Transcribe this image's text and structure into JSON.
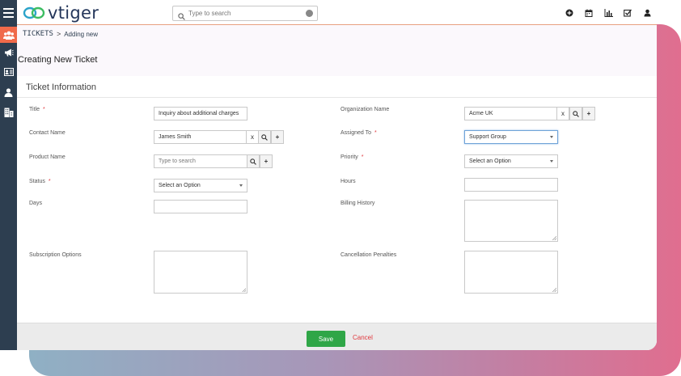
{
  "brand": {
    "name": "vtiger"
  },
  "search": {
    "placeholder": "Type to search"
  },
  "top_icons": [
    "plus-circle-icon",
    "calendar-icon",
    "bar-chart-icon",
    "checkbox-icon",
    "user-icon"
  ],
  "sidebar": {
    "items": [
      "contacts-icon",
      "megaphone-icon",
      "id-card-icon",
      "person-icon",
      "building-icon"
    ]
  },
  "breadcrumb": {
    "module": "TICKETS",
    "separator": ">",
    "current": "Adding new"
  },
  "page": {
    "title": "Creating New Ticket"
  },
  "section": {
    "title": "Ticket Information"
  },
  "form": {
    "title_label": "Title",
    "title_value": "Inquiry about additional charges",
    "contact_label": "Contact Name",
    "contact_value": "James Smith",
    "product_label": "Product Name",
    "product_placeholder": "Type to search",
    "status_label": "Status",
    "status_value": "Select an Option",
    "days_label": "Days",
    "subscription_label": "Subscription Options",
    "org_label": "Organization Name",
    "org_value": "Acme UK",
    "assigned_label": "Assigned To",
    "assigned_value": "Support Group",
    "priority_label": "Priority",
    "priority_value": "Select an Option",
    "hours_label": "Hours",
    "billing_label": "Billing History",
    "cancellation_label": "Cancellation Penalties",
    "required_mark": "*",
    "clear_mark": "x",
    "add_mark": "+"
  },
  "footer": {
    "save_label": "Save",
    "cancel_label": "Cancel"
  },
  "colors": {
    "sidebar": "#2d3e50",
    "accent": "#f06a4a",
    "save": "#2fa647",
    "cancel": "#e0393e"
  }
}
